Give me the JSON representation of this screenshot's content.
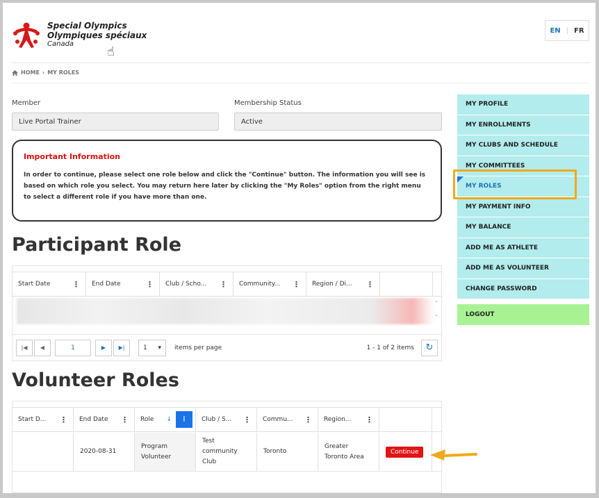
{
  "header": {
    "brand_line1": "Special Olympics",
    "brand_line2": "Olympiques spéciaux",
    "brand_line3": "Canada",
    "lang_en": "EN",
    "lang_fr": "FR"
  },
  "breadcrumb": {
    "home": "HOME",
    "current": "MY ROLES"
  },
  "form": {
    "member_label": "Member",
    "member_value": "Live Portal Trainer",
    "status_label": "Membership Status",
    "status_value": "Active"
  },
  "info": {
    "title": "Important Information",
    "text": "In order to continue, please select one role below and click the \"Continue\" button. The information you will see is based on which role you select. You may return here later by clicking the \"My Roles\" option from the right menu to select a different role if you have more than one."
  },
  "participant": {
    "title": "Participant Role",
    "columns": [
      "Start Date",
      "End Date",
      "Club / Scho...",
      "Community...",
      "Region / Di..."
    ],
    "pager": {
      "page": "1",
      "page_size": "1",
      "items_per_page": "items per page",
      "range": "1 - 1 of 2 items"
    }
  },
  "volunteer": {
    "title": "Volunteer Roles",
    "columns": [
      "Start D...",
      "End Date",
      "Role",
      "Club / S...",
      "Commu...",
      "Region..."
    ],
    "row": {
      "start": "",
      "end": "2020-08-31",
      "role": "Program Volunteer",
      "club": "Test community Club",
      "community": "Toronto",
      "region": "Greater Toronto Area",
      "action": "Continue"
    }
  },
  "menu": {
    "items": [
      "MY PROFILE",
      "MY ENROLLMENTS",
      "MY CLUBS AND SCHEDULE",
      "MY COMMITTEES",
      "MY ROLES",
      "MY PAYMENT INFO",
      "MY BALANCE",
      "ADD ME AS ATHLETE",
      "ADD ME AS VOLUNTEER",
      "CHANGE PASSWORD"
    ],
    "logout": "LOGOUT"
  },
  "colors": {
    "accent": "#1a73b8",
    "menu_bg": "#b2ecec",
    "logout_bg": "#a8f294",
    "highlight": "#f0a81c",
    "danger": "#e21515"
  }
}
